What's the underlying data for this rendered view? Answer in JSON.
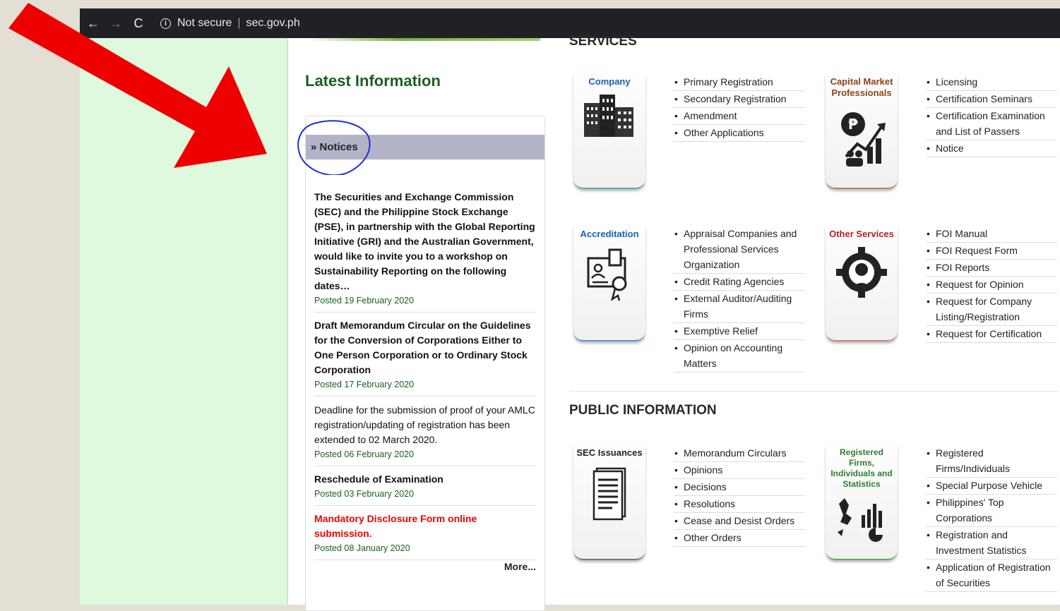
{
  "browser": {
    "back": "←",
    "forward": "→",
    "reload": "C",
    "security": "Not secure",
    "url": "sec.gov.ph"
  },
  "services_title": "SERVICES",
  "latest": {
    "title": "Latest Information",
    "tab": "» Notices",
    "notices": [
      {
        "text": "The Securities and Exchange Commission (SEC) and the Philippine Stock Exchange (PSE), in partnership with the Global Reporting Initiative (GRI) and the Australian Government, would like to invite you to a workshop on Sustainability Reporting on the following dates…",
        "date": "Posted 19 February 2020"
      },
      {
        "text": "Draft Memorandum Circular on the Guidelines for the Conversion of Corporations Either to One Person Corporation or to Ordinary Stock Corporation",
        "date": "Posted 17 February 2020"
      },
      {
        "text": "Deadline for the submission of proof of your AMLC registration/updating of registration has been extended to 02 March 2020.",
        "date": "Posted 06 February 2020"
      },
      {
        "text": "Reschedule of Examination",
        "date": "Posted 03 February 2020"
      },
      {
        "text": "Mandatory Disclosure Form online submission.",
        "date": "Posted 08 January 2020"
      }
    ],
    "more": "More..."
  },
  "services": {
    "company": {
      "label": "Company",
      "links": [
        "Primary Registration",
        "Secondary Registration",
        "Amendment",
        "Other Applications"
      ]
    },
    "capital": {
      "label": "Capital Market Professionals",
      "links": [
        "Licensing",
        "Certification Seminars",
        "Certification Examination and List of Passers",
        "Notice"
      ]
    },
    "accreditation": {
      "label": "Accreditation",
      "links": [
        "Appraisal Companies and Professional Services Organization",
        "Credit Rating Agencies",
        "External Auditor/Auditing Firms",
        "Exemptive Relief",
        "Opinion on Accounting Matters"
      ]
    },
    "other": {
      "label": "Other Services",
      "links": [
        "FOI Manual",
        "FOI Request Form",
        "FOI Reports",
        "Request for Opinion",
        "Request for Company Listing/Registration",
        "Request for Certification"
      ]
    }
  },
  "public_title": "PUBLIC INFORMATION",
  "public": {
    "issuances": {
      "label": "SEC Issuances",
      "links": [
        "Memorandum Circulars",
        "Opinions",
        "Decisions",
        "Resolutions",
        "Cease and Desist Orders",
        "Other Orders"
      ]
    },
    "registered": {
      "label": "Registered Firms, Individuals and Statistics",
      "links": [
        "Registered Firms/Individuals",
        "Special Purpose Vehicle",
        "Philippines' Top Corporations",
        "Registration and Investment Statistics",
        "Application of Registration of Securities"
      ]
    }
  },
  "colors": {
    "green_title": "#1b5e20",
    "card_blue": "#1a5fb4",
    "card_red": "#b22222",
    "card_green": "#2e7d32",
    "card_brown": "#8b4513",
    "annotation_arrow": "#ee0000",
    "annotation_circle": "#1f2fd1"
  }
}
